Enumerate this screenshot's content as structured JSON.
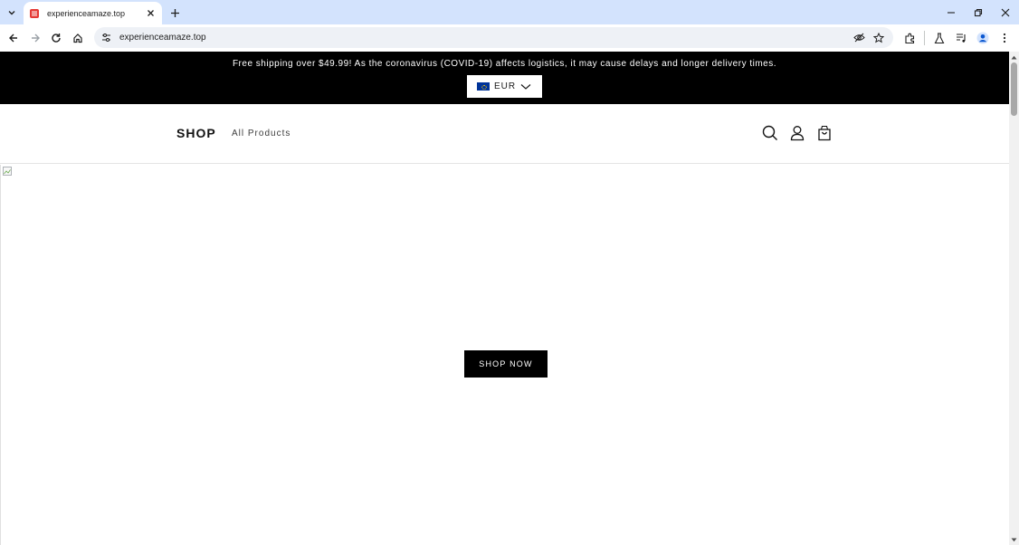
{
  "browser": {
    "tab_title": "experienceamaze.top",
    "url": "experienceamaze.top"
  },
  "announcement": {
    "text": "Free shipping over $49.99! As the coronavirus (COVID-19) affects logistics, it may cause delays and longer delivery times.",
    "currency": "EUR"
  },
  "header": {
    "logo": "SHOP",
    "nav": [
      "All Products"
    ]
  },
  "hero": {
    "cta": "SHOP NOW"
  },
  "colors": {
    "tabstrip": "#d3e3fd",
    "announcement_bg": "#000000",
    "button_bg": "#000000",
    "flag_blue": "#003399"
  }
}
